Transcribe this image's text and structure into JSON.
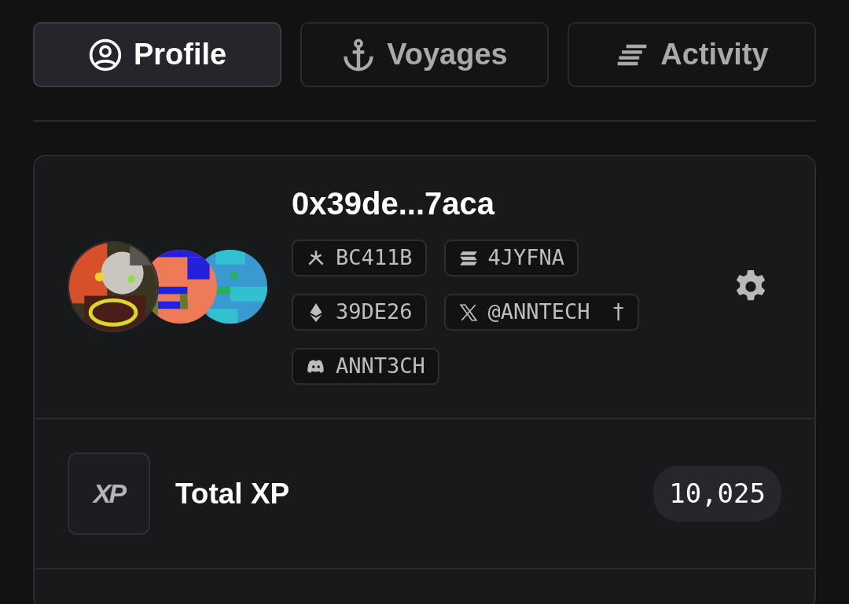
{
  "tabs": [
    {
      "kind": "profile",
      "label": "Profile",
      "selected": true
    },
    {
      "kind": "anchor",
      "label": "Voyages",
      "selected": false
    },
    {
      "kind": "lines",
      "label": "Activity",
      "selected": false
    }
  ],
  "profile": {
    "address": "0x39de...7aca",
    "tags": [
      {
        "kind": "tripod",
        "label": "BC411B"
      },
      {
        "kind": "stripes",
        "label": "4JYFNA"
      },
      {
        "kind": "diamond",
        "label": "39DE26"
      },
      {
        "kind": "x",
        "label": "@ANNTECH",
        "suffix": "†"
      },
      {
        "kind": "controller",
        "label": "ANNT3CH"
      }
    ]
  },
  "xp": {
    "icon_text": "XP",
    "label": "Total XP",
    "value": "10,025"
  }
}
